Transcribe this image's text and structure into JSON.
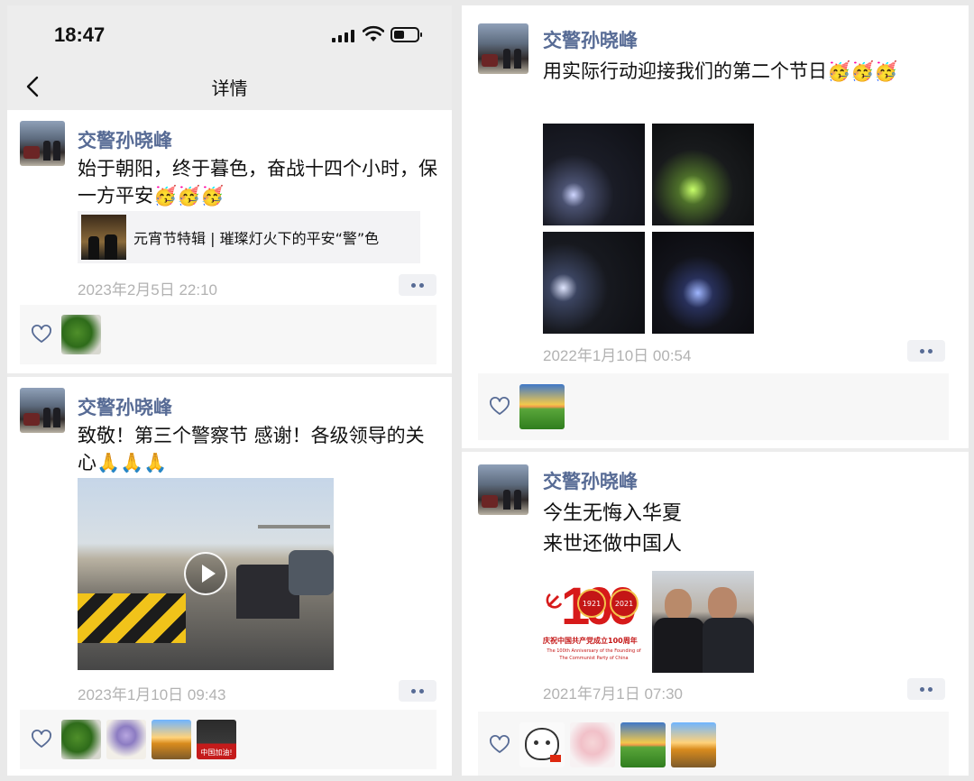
{
  "status_bar": {
    "time": "18:47"
  },
  "nav": {
    "title": "详情"
  },
  "left_posts": [
    {
      "name": "交警孙晓峰",
      "text": "始于朝阳，终于暮色，奋战十四个小时，保一方平安🥳🥳🥳",
      "link_title": "元宵节特辑 | 璀璨灯火下的平安“警”色",
      "time": "2023年2月5日 22:10"
    },
    {
      "name": "交警孙晓峰",
      "text": "致敬！第三个警察节 感谢！各级领导的关心🙏🙏🙏",
      "time": "2023年1月10日 09:43",
      "like_sticker": "中国加油!"
    }
  ],
  "right_posts": [
    {
      "name": "交警孙晓峰",
      "text": "用实际行动迎接我们的第二个节日🥳🥳🥳",
      "time": "2022年1月10日 00:54"
    },
    {
      "name": "交警孙晓峰",
      "text_line1": "今生无悔入华夏",
      "text_line2": "来世还做中国人",
      "time": "2021年7月1日 07:30",
      "poster": {
        "year_left": "1921",
        "year_right": "2021",
        "caption_cn": "庆祝中国共产党成立100周年",
        "caption_en1": "The 100th Anniversary of the Founding of",
        "caption_en2": "The Communist Party of China"
      }
    }
  ],
  "colors": {
    "nickname": "#576b95",
    "meta": "#b2b2b2",
    "panel_bg": "#ffffff",
    "bar_bg": "#ededed"
  },
  "icons": [
    "back-chevron-icon",
    "signal-icon",
    "wifi-icon",
    "battery-icon",
    "heart-outline-icon",
    "more-dots-icon",
    "play-icon"
  ]
}
